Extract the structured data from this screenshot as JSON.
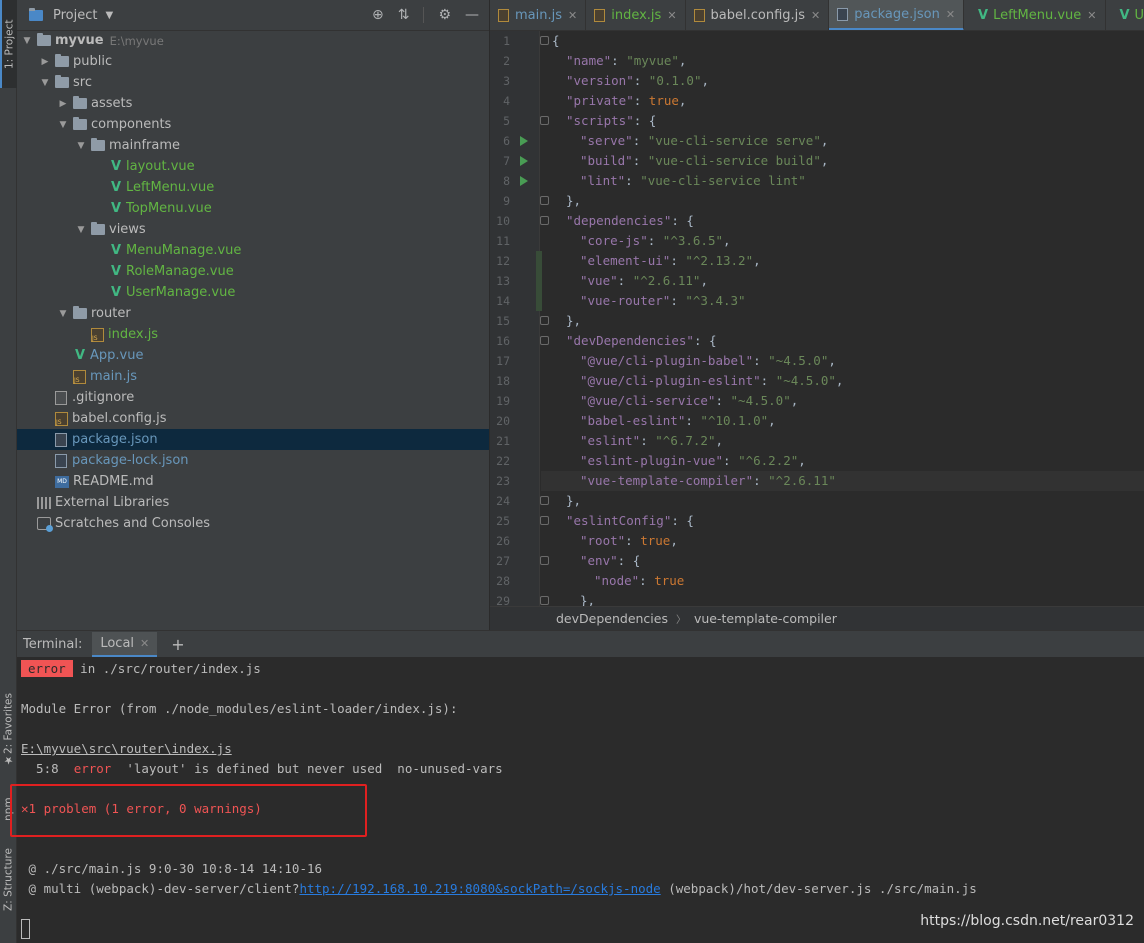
{
  "tool_strip": {
    "project": "1: Project",
    "favorites": "2: Favorites",
    "npm": "npm",
    "structure": "Z: Structure"
  },
  "project_panel": {
    "title": "Project",
    "tree": [
      {
        "label": "myvue",
        "path": "E:\\myvue"
      },
      {
        "label": "public"
      },
      {
        "label": "src"
      },
      {
        "label": "assets"
      },
      {
        "label": "components"
      },
      {
        "label": "mainframe"
      },
      {
        "label": "layout.vue"
      },
      {
        "label": "LeftMenu.vue"
      },
      {
        "label": "TopMenu.vue"
      },
      {
        "label": "views"
      },
      {
        "label": "MenuManage.vue"
      },
      {
        "label": "RoleManage.vue"
      },
      {
        "label": "UserManage.vue"
      },
      {
        "label": "router"
      },
      {
        "label": "index.js"
      },
      {
        "label": "App.vue"
      },
      {
        "label": "main.js"
      },
      {
        "label": ".gitignore"
      },
      {
        "label": "babel.config.js"
      },
      {
        "label": "package.json"
      },
      {
        "label": "package-lock.json"
      },
      {
        "label": "README.md"
      },
      {
        "label": "External Libraries"
      },
      {
        "label": "Scratches and Consoles"
      }
    ]
  },
  "tabs": [
    "main.js",
    "index.js",
    "babel.config.js",
    "package.json",
    "LeftMenu.vue",
    "UserMan"
  ],
  "editor": {
    "line_numbers": [
      "1",
      "2",
      "3",
      "4",
      "5",
      "6",
      "7",
      "8",
      "9",
      "10",
      "11",
      "12",
      "13",
      "14",
      "15",
      "16",
      "17",
      "18",
      "19",
      "20",
      "21",
      "22",
      "23",
      "24",
      "25",
      "26",
      "27",
      "28",
      "29"
    ],
    "lines": [
      [
        "{"
      ],
      [
        "\"name\"",
        ": ",
        "\"myvue\"",
        ","
      ],
      [
        "\"version\"",
        ": ",
        "\"0.1.0\"",
        ","
      ],
      [
        "\"private\"",
        ": ",
        "true",
        ","
      ],
      [
        "\"scripts\"",
        ": {"
      ],
      [
        "\"serve\"",
        ": ",
        "\"vue-cli-service serve\"",
        ","
      ],
      [
        "\"build\"",
        ": ",
        "\"vue-cli-service build\"",
        ","
      ],
      [
        "\"lint\"",
        ": ",
        "\"vue-cli-service lint\""
      ],
      [
        "},"
      ],
      [
        "\"dependencies\"",
        ": {"
      ],
      [
        "\"core-js\"",
        ": ",
        "\"^3.6.5\"",
        ","
      ],
      [
        "\"element-ui\"",
        ": ",
        "\"^2.13.2\"",
        ","
      ],
      [
        "\"vue\"",
        ": ",
        "\"^2.6.11\"",
        ","
      ],
      [
        "\"vue-router\"",
        ": ",
        "\"^3.4.3\""
      ],
      [
        "},"
      ],
      [
        "\"devDependencies\"",
        ": {"
      ],
      [
        "\"@vue/cli-plugin-babel\"",
        ": ",
        "\"~4.5.0\"",
        ","
      ],
      [
        "\"@vue/cli-plugin-eslint\"",
        ": ",
        "\"~4.5.0\"",
        ","
      ],
      [
        "\"@vue/cli-service\"",
        ": ",
        "\"~4.5.0\"",
        ","
      ],
      [
        "\"babel-eslint\"",
        ": ",
        "\"^10.1.0\"",
        ","
      ],
      [
        "\"eslint\"",
        ": ",
        "\"^6.7.2\"",
        ","
      ],
      [
        "\"eslint-plugin-vue\"",
        ": ",
        "\"^6.2.2\"",
        ","
      ],
      [
        "\"vue-template-compiler\"",
        ": ",
        "\"^2.6.11\""
      ],
      [
        "},"
      ],
      [
        "\"eslintConfig\"",
        ": {"
      ],
      [
        "\"root\"",
        ": ",
        "true",
        ","
      ],
      [
        "\"env\"",
        ": {"
      ],
      [
        "\"node\"",
        ": ",
        "true"
      ],
      [
        "},"
      ]
    ]
  },
  "breadcrumb": [
    "devDependencies",
    "vue-template-compiler"
  ],
  "terminal": {
    "label": "Terminal:",
    "tab": "Local",
    "error_badge": "error",
    "error_in": " in ./src/router/index.js",
    "module_error": "Module Error (from ./node_modules/eslint-loader/index.js):",
    "file_path": "E:\\myvue\\src\\router\\index.js",
    "problem_pos": "  5:8  ",
    "problem_level": "error",
    "problem_msg": "  'layout' is defined but never used  no-unused-vars",
    "summary": "1 problem (1 error, 0 warnings)",
    "stack1": " @ ./src/main.js 9:0-30 10:8-14 14:10-16",
    "stack2_pre": " @ multi (webpack)-dev-server/client?",
    "stack2_link": "http://192.168.10.219:8080&sockPath=/sockjs-node",
    "stack2_post": " (webpack)/hot/dev-server.js ./src/main.js"
  },
  "watermark": "https://blog.csdn.net/rear0312"
}
